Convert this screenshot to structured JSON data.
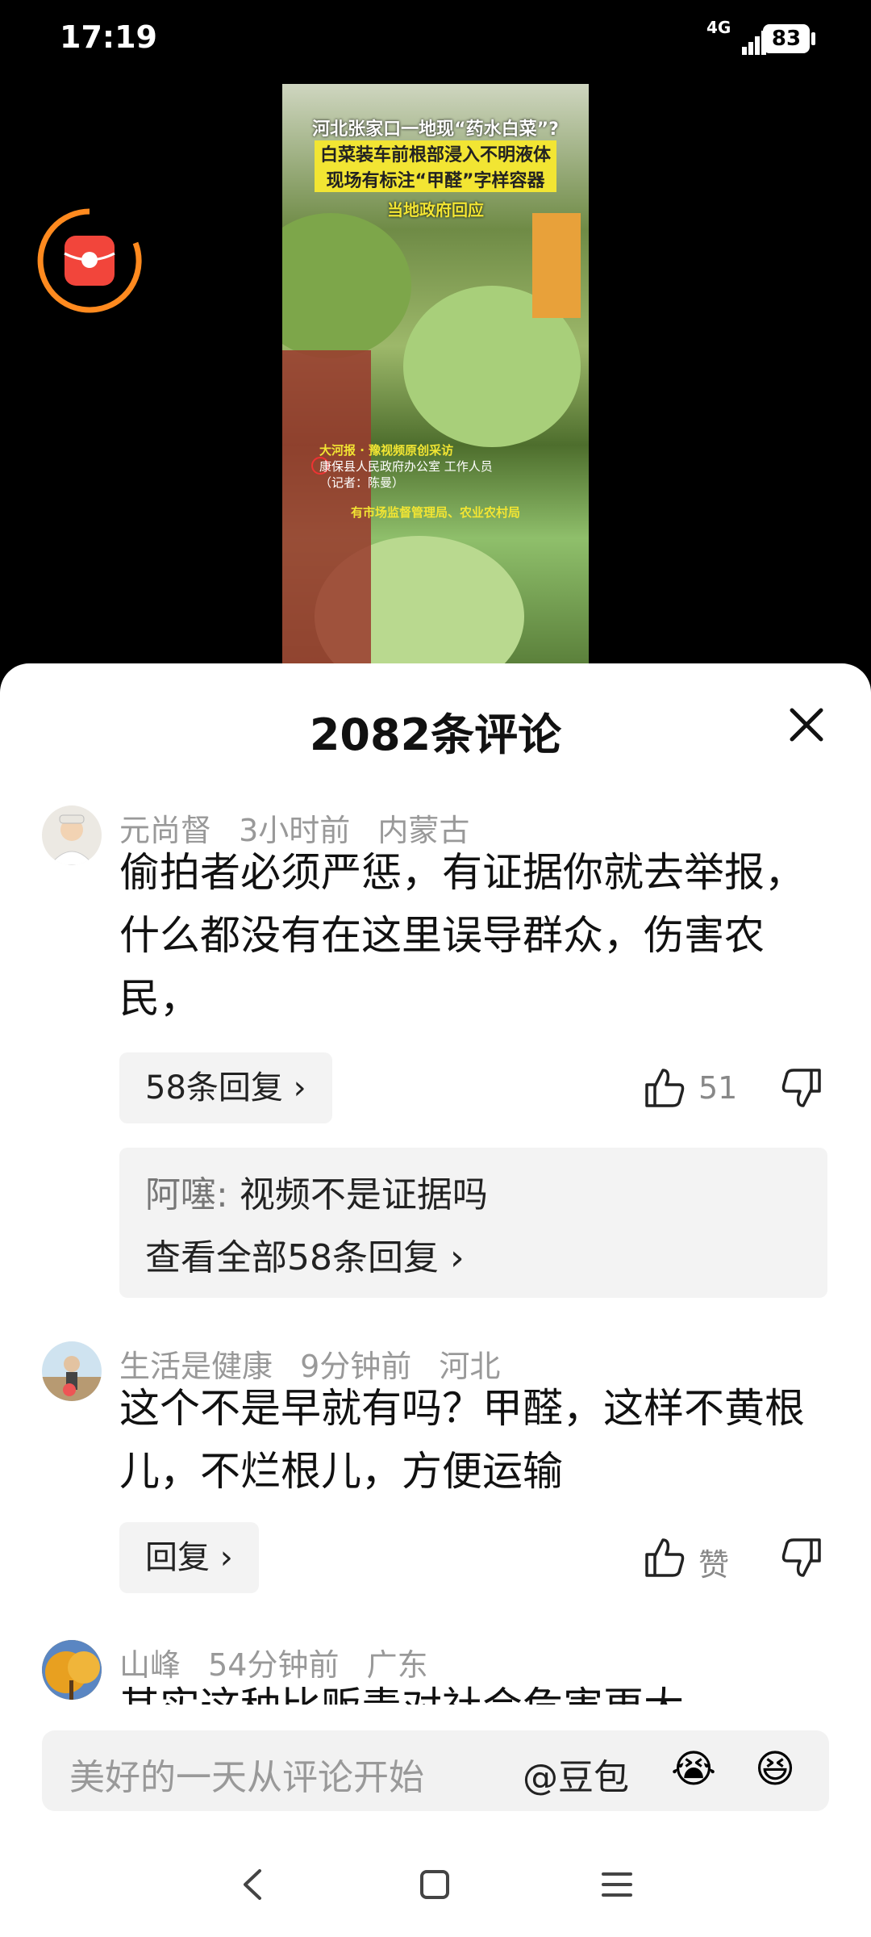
{
  "status": {
    "time": "17:19",
    "network": "4G",
    "battery": "83"
  },
  "video": {
    "headline_1": "河北张家口一地现“药水白菜”?",
    "headline_2": "白菜装车前根部浸入不明液体",
    "headline_3": "现场有标注“甲醛”字样容器",
    "headline_4": "当地政府回应",
    "source_1": "大河报 · 豫视频原创采访",
    "source_2": "康保县人民政府办公室 工作人员",
    "source_3": "（记者：陈曼）",
    "caption": "有市场监督管理局、农业农村局"
  },
  "comments_panel": {
    "title": "2082条评论",
    "comments": [
      {
        "user": "元尚督",
        "time": "3小时前",
        "region": "内蒙古",
        "text": "偷拍者必须严惩，有证据你就去举报，什么都没有在这里误导群众，伤害农民，",
        "reply_button": "58条回复 ›",
        "likes": "51",
        "preview_user": "阿噻:",
        "preview_text": "视频不是证据吗",
        "view_all": "查看全部58条回复 ›"
      },
      {
        "user": "生活是健康",
        "time": "9分钟前",
        "region": "河北",
        "text": "这个不是早就有吗？甲醛，这样不黄根儿，不烂根儿，方便运输",
        "reply_button": "回复 ›",
        "likes": "赞"
      },
      {
        "user": "山峰",
        "time": "54分钟前",
        "region": "广东",
        "text": "其实这种比贩毒对社会危害更大"
      }
    ]
  },
  "input": {
    "placeholder": "美好的一天从评论开始",
    "mention": "@豆包",
    "emoji_1": "😭",
    "emoji_2": "😆"
  }
}
